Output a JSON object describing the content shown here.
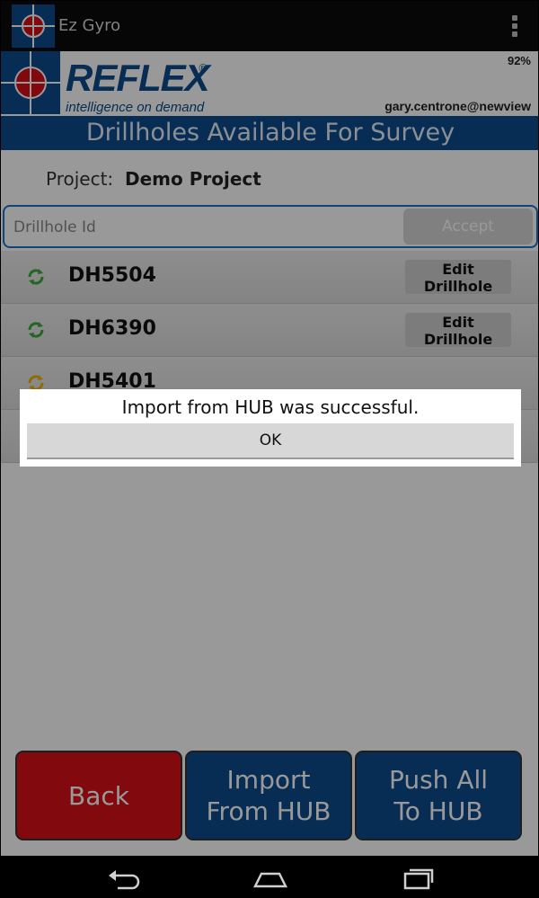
{
  "app": {
    "title": "Ez Gyro"
  },
  "header": {
    "logo_text": "REFLEX",
    "logo_reg": "®",
    "tagline": "intelligence on demand",
    "battery": "92%",
    "user": "gary.centrone@newview",
    "title": "Drillholes Available For Survey"
  },
  "project": {
    "label": "Project:",
    "name": "Demo Project"
  },
  "search": {
    "placeholder": "Drillhole Id",
    "value": "",
    "accept_label": "Accept"
  },
  "drillholes": [
    {
      "id": "DH5504",
      "status_color": "#3aaa35",
      "edit_label": "Edit Drillhole"
    },
    {
      "id": "DH6390",
      "status_color": "#3aaa35",
      "edit_label": "Edit Drillhole"
    },
    {
      "id": "DH5401",
      "status_color": "#f0b400",
      "edit_label": ""
    }
  ],
  "buttons": {
    "back": "Back",
    "import_line1": "Import",
    "import_line2": "From HUB",
    "push_line1": "Push All",
    "push_line2": "To HUB"
  },
  "dialog": {
    "message": "Import from HUB was successful.",
    "ok_label": "OK"
  },
  "colors": {
    "brand_blue": "#0c4b8c",
    "back_red": "#d90f18",
    "accent_blue": "#1a73c8"
  }
}
